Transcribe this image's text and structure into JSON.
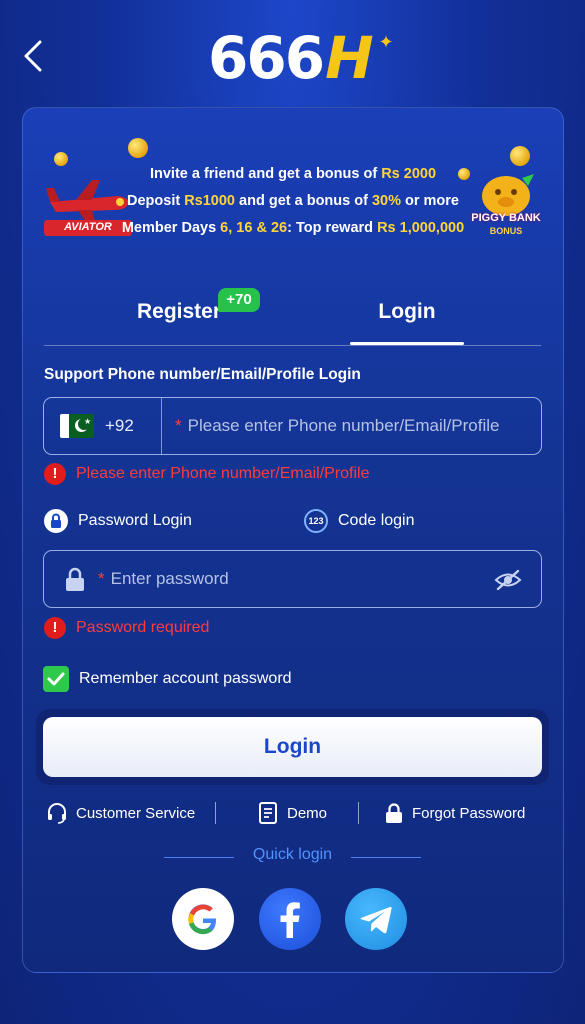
{
  "header": {
    "logo_text": "666",
    "logo_accent": "H",
    "back_icon": "chevron-left-icon"
  },
  "promo": {
    "line1_prefix": "Invite a friend and get a bonus of ",
    "line1_highlight": "Rs 2000",
    "line2_a": "Deposit ",
    "line2_b": "Rs1000",
    "line2_c": " and get a bonus of ",
    "line2_d": "30%",
    "line2_e": " or more",
    "line3_a": "Member Days ",
    "line3_b": "6, 16 & 26",
    "line3_c": ": Top reward ",
    "line3_d": "Rs 1,000,000",
    "aviator_label": "AVIATOR",
    "piggy_label": "PIGGY BANK",
    "piggy_sub": "BONUS"
  },
  "tabs": {
    "register_label": "Register",
    "register_badge": "+70",
    "login_label": "Login",
    "active": "Login"
  },
  "form": {
    "section_label": "Support Phone number/Email/Profile Login",
    "country_code": "+92",
    "phone_required_mark": "*",
    "phone_placeholder": "Please enter Phone number/Email/Profile",
    "phone_error": "Please enter Phone number/Email/Profile",
    "mode_password": "Password Login",
    "mode_code": "Code login",
    "code_icon_text": "123",
    "password_required_mark": "*",
    "password_placeholder": "Enter password",
    "password_error": "Password required",
    "remember_label": "Remember account password",
    "remember_checked": true,
    "login_button": "Login"
  },
  "links": {
    "customer_service": "Customer Service",
    "demo": "Demo",
    "forgot_password": "Forgot Password"
  },
  "quick_login": {
    "label": "Quick login",
    "providers": [
      "google-icon",
      "facebook-icon",
      "telegram-icon"
    ]
  },
  "colors": {
    "accent_yellow": "#ffd43a",
    "error_red": "#ff3b3b",
    "success_green": "#2ec94b",
    "button_text_blue": "#1a47c8",
    "quick_login_blue": "#4f93ff"
  }
}
